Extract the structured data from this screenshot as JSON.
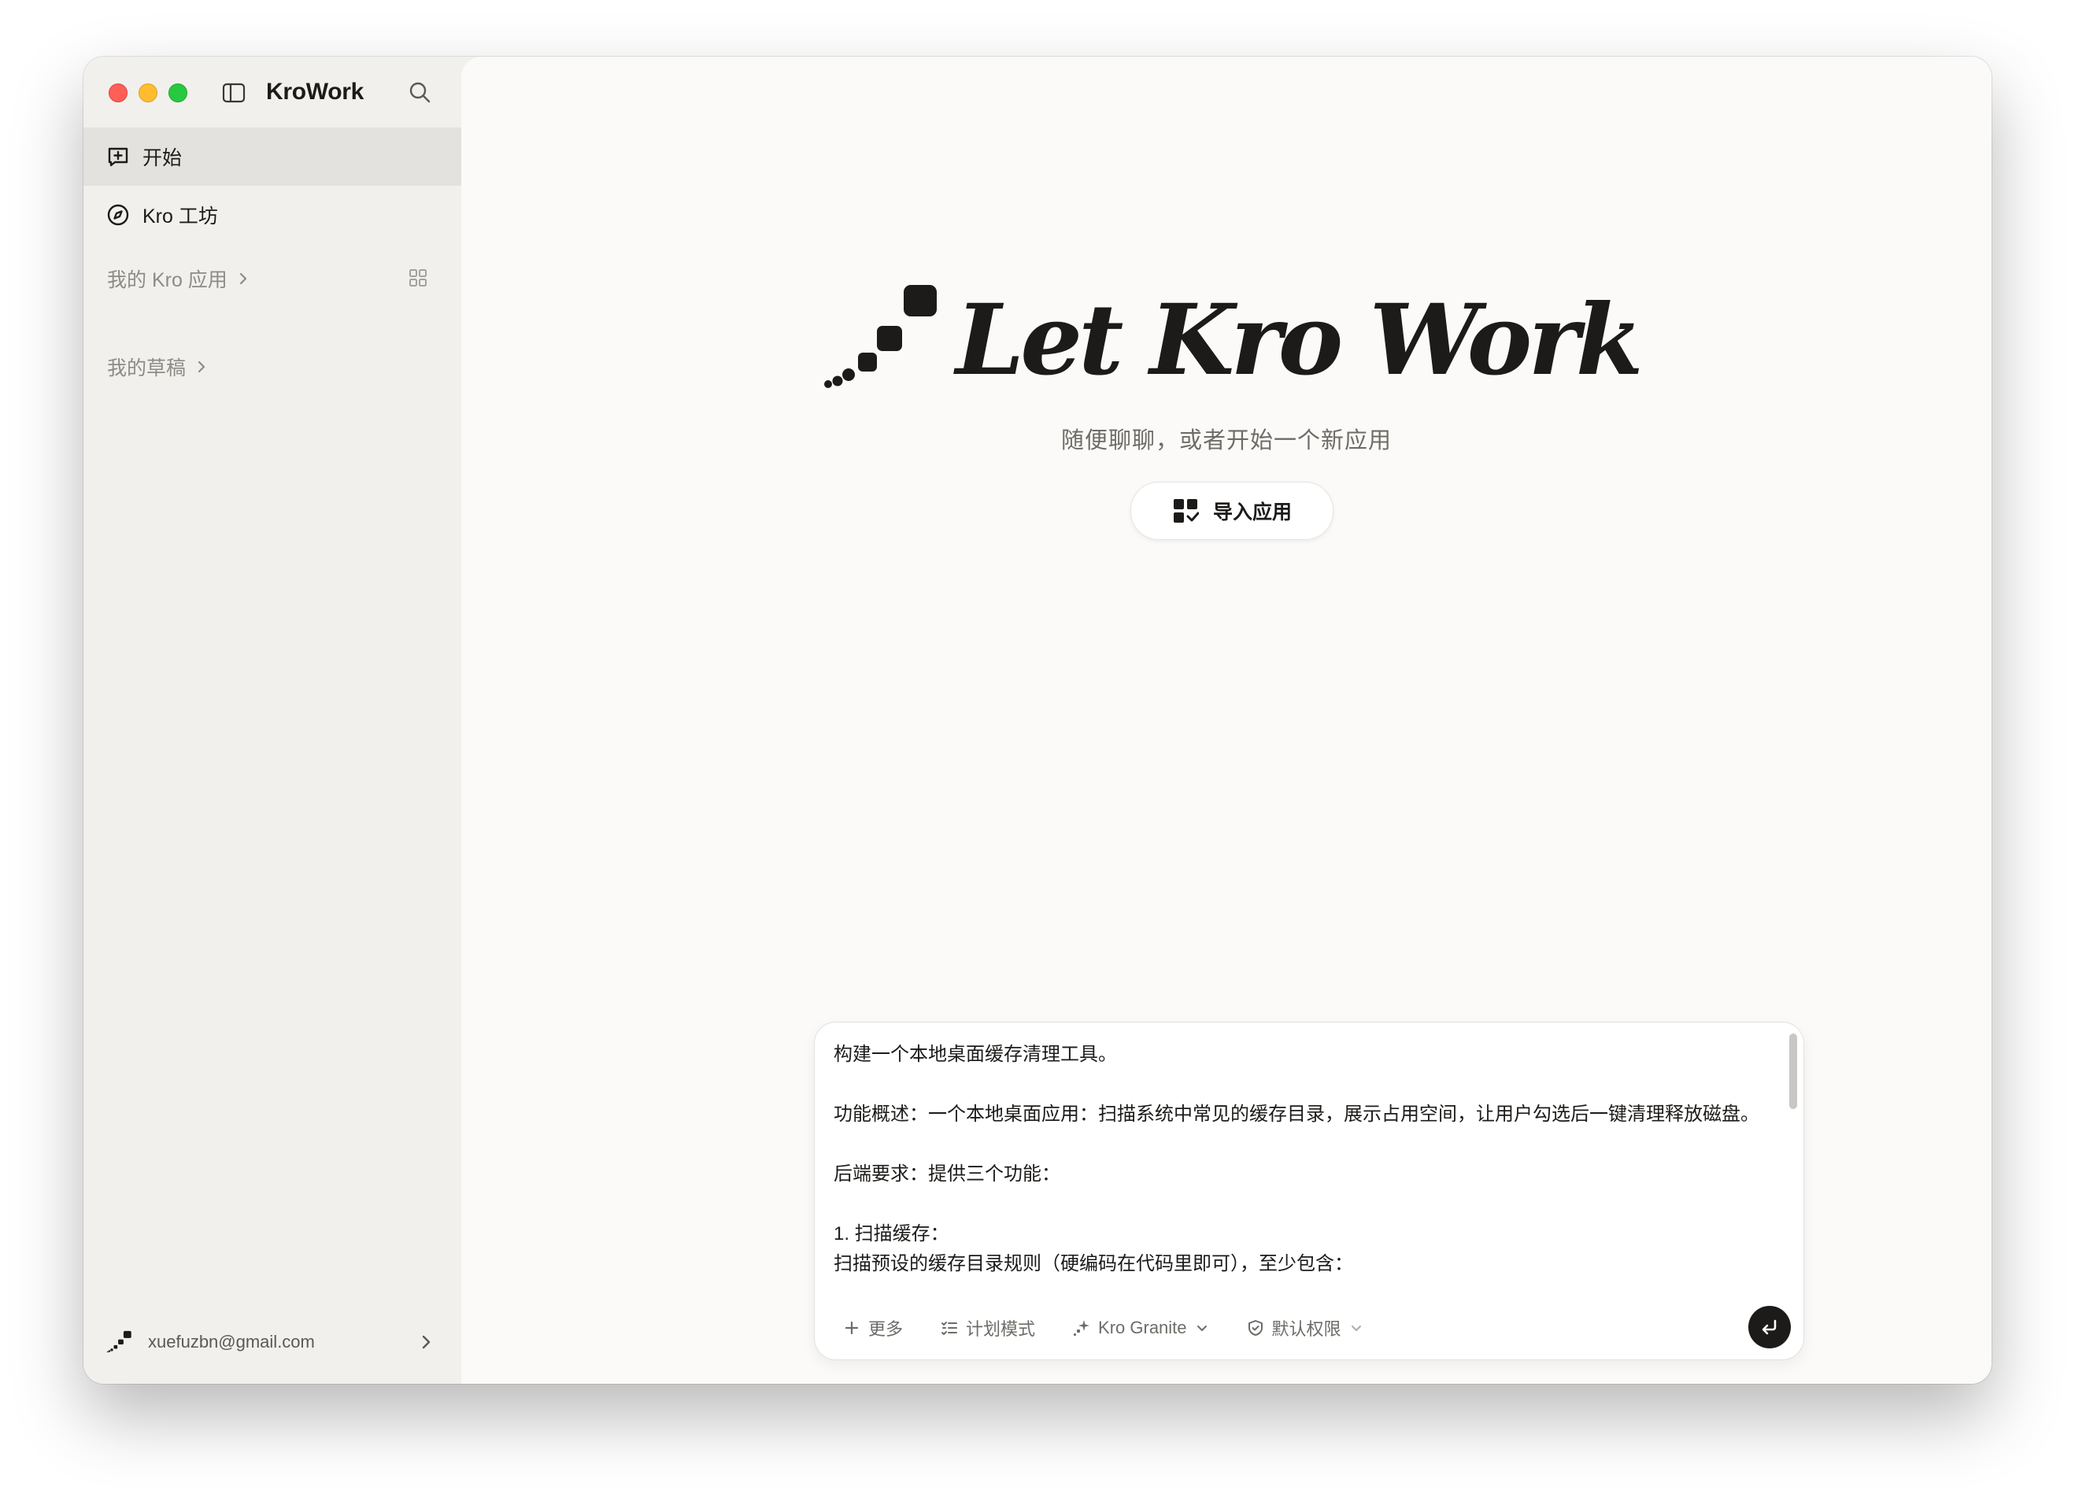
{
  "app": {
    "title": "KroWork"
  },
  "sidebar": {
    "items": [
      {
        "label": "开始",
        "icon": "new-chat-icon",
        "active": true
      },
      {
        "label": "Kro 工坊",
        "icon": "compass-icon",
        "active": false
      }
    ],
    "sections": [
      {
        "label": "我的 Kro 应用",
        "icon": "chevron-right-icon"
      },
      {
        "label": "我的草稿",
        "icon": "chevron-right-icon"
      }
    ],
    "user": {
      "email": "xuefuzbn@gmail.com"
    }
  },
  "main": {
    "hero_title": "Let Kro Work",
    "subtitle": "随便聊聊，或者开始一个新应用",
    "import_button": "导入应用"
  },
  "composer": {
    "lines": [
      "构建一个本地桌面缓存清理工具。",
      "",
      "功能概述：一个本地桌面应用：扫描系统中常见的缓存目录，展示占用空间，让用户勾选后一键清理释放磁盘。",
      "",
      "后端要求：提供三个功能：",
      "",
      "1. 扫描缓存：",
      "扫描预设的缓存目录规则（硬编码在代码里即可），至少包含："
    ],
    "toolbar": {
      "more": "更多",
      "plan_mode": "计划模式",
      "model": "Kro Granite",
      "permission": "默认权限"
    }
  },
  "colors": {
    "accent": "#1d1b19",
    "sidebar_bg": "#f1f0ed",
    "main_bg": "#fbfaf8",
    "close": "#fe5f57",
    "minimize": "#febc2e",
    "zoom": "#28c840"
  }
}
